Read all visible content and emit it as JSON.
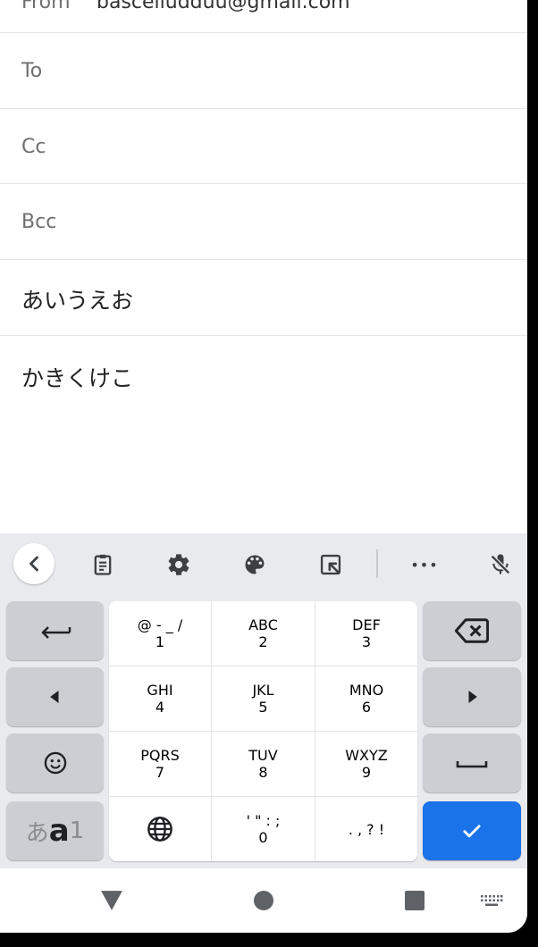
{
  "compose": {
    "from_label": "From",
    "from_value": "bascelludduu@gmail.com",
    "to_label": "To",
    "cc_label": "Cc",
    "bcc_label": "Bcc",
    "subject": "あいうえお",
    "body": "かきくけこ"
  },
  "keyboard": {
    "toolbar_icons": [
      "chevron-left-icon",
      "clipboard-icon",
      "gear-icon",
      "palette-icon",
      "resize-icon",
      "more-icon",
      "mic-off-icon"
    ],
    "more_label": "•••",
    "keys": {
      "r1": [
        {
          "main": "@ - _ /",
          "sub": "1"
        },
        {
          "main": "ABC",
          "sub": "2"
        },
        {
          "main": "DEF",
          "sub": "3"
        }
      ],
      "r2": [
        {
          "main": "GHI",
          "sub": "4"
        },
        {
          "main": "JKL",
          "sub": "5"
        },
        {
          "main": "MNO",
          "sub": "6"
        }
      ],
      "r3": [
        {
          "main": "PQRS",
          "sub": "7"
        },
        {
          "main": "TUV",
          "sub": "8"
        },
        {
          "main": "WXYZ",
          "sub": "9"
        }
      ],
      "r4": [
        {
          "main": "' \" : ;",
          "sub": "0"
        },
        {
          "main": ". , ? !",
          "sub": ""
        }
      ]
    },
    "mode_key": {
      "kana": "あ",
      "alpha": "a",
      "num": "1"
    },
    "accent_color": "#1a73e8"
  }
}
